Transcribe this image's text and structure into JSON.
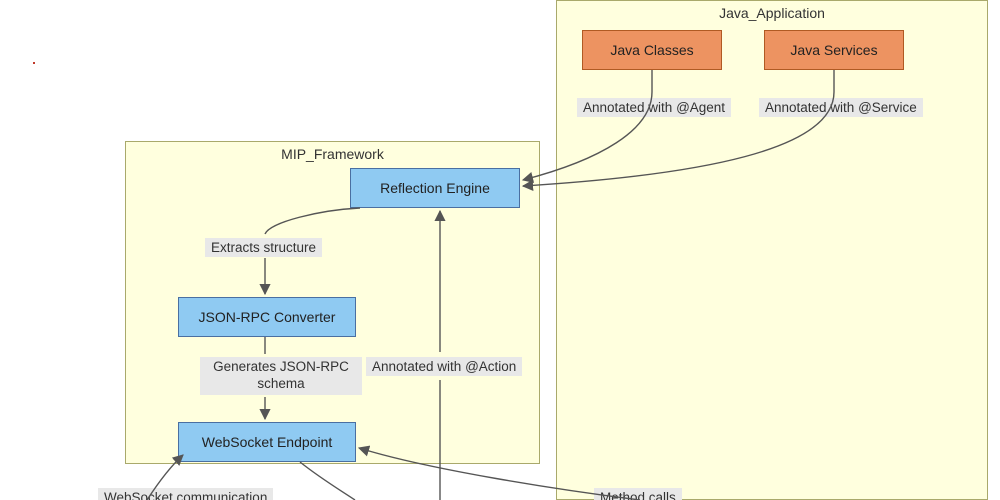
{
  "clusters": {
    "mip": {
      "title": "MIP_Framework"
    },
    "java_app": {
      "title": "Java_Application"
    }
  },
  "nodes": {
    "java_classes": {
      "label": "Java Classes"
    },
    "java_services": {
      "label": "Java Services"
    },
    "reflection": {
      "label": "Reflection Engine"
    },
    "json_rpc": {
      "label": "JSON-RPC Converter"
    },
    "ws_endpoint": {
      "label": "WebSocket Endpoint"
    }
  },
  "edges": {
    "agent": {
      "label": "Annotated with @Agent"
    },
    "service": {
      "label": "Annotated with @Service"
    },
    "extracts": {
      "label": "Extracts structure"
    },
    "gen_schema": {
      "label": "Generates JSON-RPC schema"
    },
    "action": {
      "label": "Annotated with @Action"
    },
    "ws_comm": {
      "label": "WebSocket communication"
    },
    "method_calls": {
      "label": "Method calls"
    }
  }
}
